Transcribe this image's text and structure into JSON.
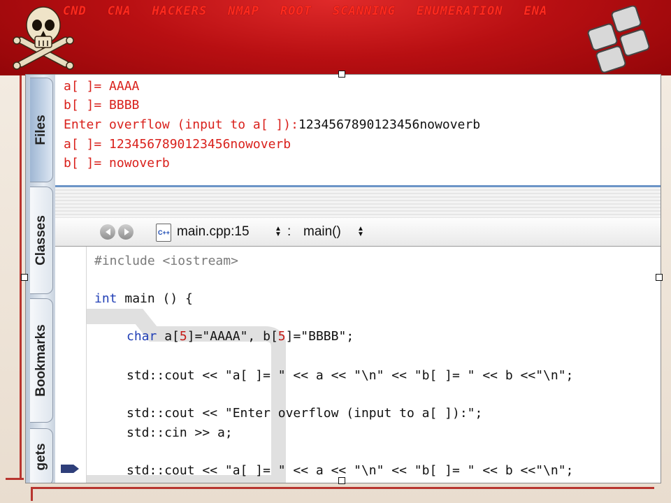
{
  "banner": {
    "words": [
      "CND",
      "CNA",
      "HACKERS",
      "NMAP",
      "ROOT",
      "SCANNING",
      "ENUMERATION",
      "ENA"
    ],
    "colors": {
      "background": "#b80f12",
      "text": "#ff2a1e"
    },
    "left_icon": "skull-crossbones-icon",
    "right_icon": "keyboard-keys-icon"
  },
  "dock": {
    "tabs": [
      {
        "label": "Files",
        "icon": "file-icon"
      },
      {
        "label": "Classes",
        "icon": "cube-icon"
      },
      {
        "label": "Bookmarks",
        "icon": "bookmark-icon"
      },
      {
        "label": "gets"
      }
    ]
  },
  "console": {
    "lines": [
      {
        "text": "a[ ]= AAAA"
      },
      {
        "text": "b[ ]= BBBB"
      },
      {
        "text": "Enter overflow (input to a[ ]):",
        "typed": "1234567890123456nowoverb"
      },
      {
        "text": "a[ ]= 1234567890123456nowoverb"
      },
      {
        "text": "b[ ]= nowoverb"
      }
    ],
    "colors": {
      "output": "#d9201b",
      "input": "#111111"
    }
  },
  "navbar": {
    "file_icon_label": "C++",
    "file_label": "main.cpp:15",
    "separator": ":",
    "function_label": "main()"
  },
  "editor": {
    "lines": {
      "include_kw": "#include",
      "include_hdr": "<iostream>",
      "main_kw": "int",
      "main_rest": "main () {",
      "decl_kw": "char",
      "decl_a": "a[",
      "decl_n1": "5",
      "decl_mid": "]=\"AAAA\", b[",
      "decl_n2": "5",
      "decl_end": "]=\"BBBB\";",
      "cout1": "std::cout << \"a[ ]= \" << a << \"\\n\" << \"b[ ]= \" << b <<\"\\n\";",
      "cout2": "std::cout << \"Enter overflow (input to a[ ]):\";",
      "cin": "std::cin >> a;",
      "cout3": "std::cout << \"a[ ]= \" << a << \"\\n\" << \"b[ ]= \" << b <<\"\\n\";"
    },
    "current_line_marker": "program-counter-arrow-icon",
    "colors": {
      "keyword": "#2240b6",
      "preprocessor": "#7a7a7a",
      "number": "#c41a16"
    }
  }
}
